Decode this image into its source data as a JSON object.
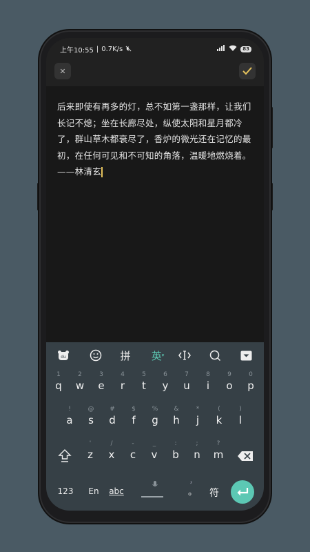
{
  "status": {
    "time": "上午10:55",
    "separator": "|",
    "speed": "0.7K/s",
    "battery": "83"
  },
  "toolbar": {
    "close_icon": "close-icon",
    "confirm_icon": "check-icon"
  },
  "editor": {
    "text": "后来即使有再多的灯，总不如第一盏那样，让我们长记不熄；坐在长廊尽处，纵使太阳和星月都冷了，群山草木都衰尽了，香炉的微光还在记忆的最初，在任何可见和不可知的角落，温暖地燃烧着。——林清玄"
  },
  "keyboard": {
    "tools": {
      "pinyin": "拼",
      "english": "英",
      "colors": {
        "accent": "#5cc8b4",
        "background": "#364046"
      }
    },
    "rows": {
      "row1": [
        {
          "hint": "1",
          "key": "q"
        },
        {
          "hint": "2",
          "key": "w"
        },
        {
          "hint": "3",
          "key": "e"
        },
        {
          "hint": "4",
          "key": "r"
        },
        {
          "hint": "5",
          "key": "t"
        },
        {
          "hint": "6",
          "key": "y"
        },
        {
          "hint": "7",
          "key": "u"
        },
        {
          "hint": "8",
          "key": "i"
        },
        {
          "hint": "9",
          "key": "o"
        },
        {
          "hint": "0",
          "key": "p"
        }
      ],
      "row2": [
        {
          "hint": "!",
          "key": "a"
        },
        {
          "hint": "@",
          "key": "s"
        },
        {
          "hint": "#",
          "key": "d"
        },
        {
          "hint": "$",
          "key": "f"
        },
        {
          "hint": "%",
          "key": "g"
        },
        {
          "hint": "&",
          "key": "h"
        },
        {
          "hint": "*",
          "key": "j"
        },
        {
          "hint": "(",
          "key": "k"
        },
        {
          "hint": ")",
          "key": "l"
        }
      ],
      "row3": [
        {
          "hint": "'",
          "key": "z"
        },
        {
          "hint": "/",
          "key": "x"
        },
        {
          "hint": "-",
          "key": "c"
        },
        {
          "hint": "_",
          "key": "v"
        },
        {
          "hint": ":",
          "key": "b"
        },
        {
          "hint": ";",
          "key": "n"
        },
        {
          "hint": "?",
          "key": "m"
        }
      ]
    },
    "bottom": {
      "numbers": "123",
      "en": "En",
      "abc": "abc",
      "comma_hint": "，",
      "period": "。",
      "symbols": "符"
    }
  }
}
